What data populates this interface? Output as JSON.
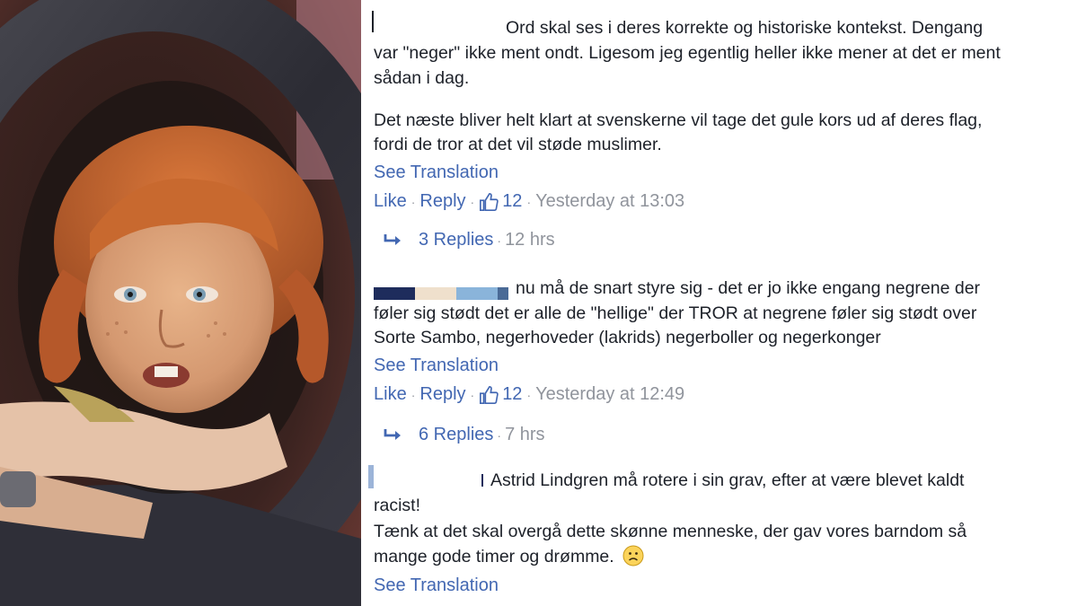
{
  "comments": [
    {
      "lines": [
        "Ord skal ses i deres korrekte og historiske kontekst. Dengang",
        "var \"neger\" ikke ment ondt. Ligesom jeg egentlig heller ikke mener at det er ment",
        "sådan i dag.",
        "Det næste bliver helt klart at svenskerne vil tage det gule kors ud af deres flag,",
        "fordi de tror at det vil støde muslimer."
      ],
      "see_translation": "See Translation",
      "like": "Like",
      "reply": "Reply",
      "likes": "12",
      "time": "Yesterday at 13:03",
      "replies": "3 Replies",
      "replies_age": "12 hrs"
    },
    {
      "lines": [
        "nu må de snart styre sig - det er jo ikke engang negrene der",
        "føler sig stødt det er alle de \"hellige\" der TROR at negrene føler sig stødt over",
        "Sorte Sambo, negerhoveder (lakrids) negerboller og negerkonger"
      ],
      "see_translation": "See Translation",
      "like": "Like",
      "reply": "Reply",
      "likes": "12",
      "time": "Yesterday at 12:49",
      "replies": "6 Replies",
      "replies_age": "7 hrs"
    },
    {
      "lines": [
        "Astrid Lindgren må rotere i sin grav, efter at være blevet kaldt",
        "racist!",
        "Tænk at det skal overgå dette skønne menneske, der gav vores barndom så",
        "mange gode timer og drømme."
      ],
      "emoji": "🙁",
      "see_translation": "See Translation"
    }
  ],
  "separator": "·",
  "icons": {
    "like": "thumbs-up-icon",
    "reply_arrow": "reply-arrow-icon",
    "emoji": "frown-emoji-icon"
  },
  "colors": {
    "link": "#4267b2",
    "meta_grey": "#90949c",
    "text": "#1d2129"
  }
}
